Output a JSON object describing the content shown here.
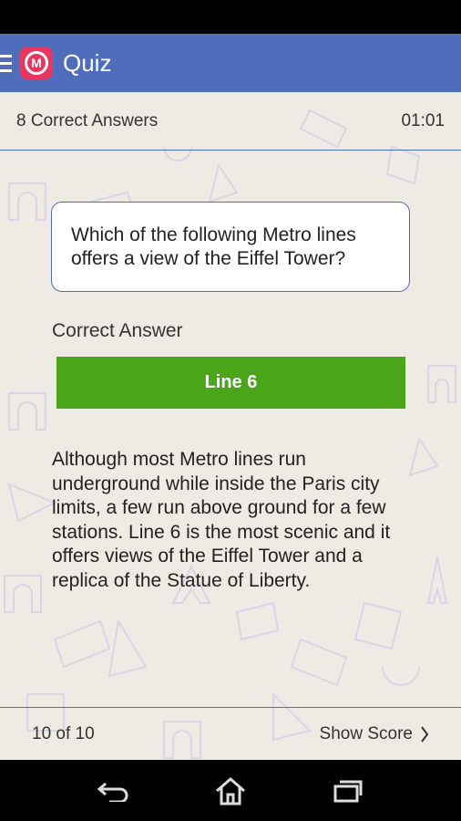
{
  "app": {
    "title": "Quiz",
    "logo_letter": "M"
  },
  "info": {
    "correct_answers": "8 Correct Answers",
    "timer": "01:01"
  },
  "question": {
    "text": "Which of the following Metro lines offers a view of the Eiffel Tower?"
  },
  "answer": {
    "label": "Correct Answer",
    "value": "Line 6",
    "color": "#4ba51a"
  },
  "explanation": {
    "text": "Although most Metro lines run underground while inside the Paris city limits, a few run above ground for a few stations. Line 6 is the most scenic and it offers views of the Eiffel Tower and a replica of the Statue of Liberty."
  },
  "footer": {
    "progress": "10 of 10",
    "show_score": "Show Score"
  },
  "colors": {
    "primary": "#4f6dbb",
    "accent": "#e8365e",
    "background": "#eeebe4"
  },
  "icons": {
    "nav": [
      "back-icon",
      "home-icon",
      "recent-apps-icon"
    ]
  }
}
